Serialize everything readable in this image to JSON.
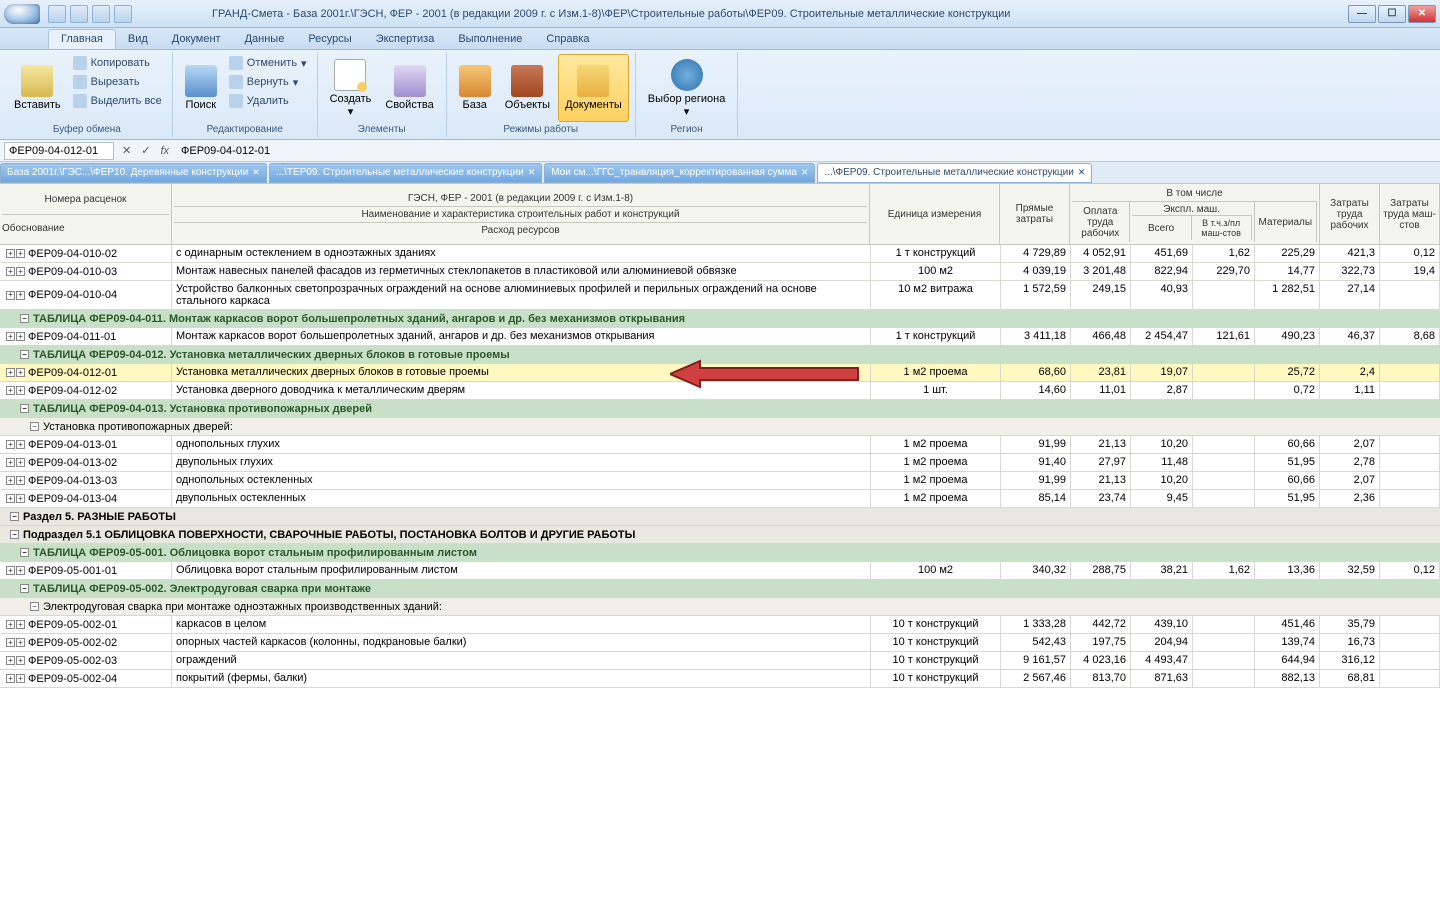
{
  "title": "ГРАНД-Смета - База 2001г.\\ГЭСН, ФЕР - 2001 (в редакции 2009 г. с Изм.1-8)\\ФЕР\\Строительные работы\\ФЕР09. Строительные металлические конструкции",
  "ribbon_tabs": [
    "Главная",
    "Вид",
    "Документ",
    "Данные",
    "Ресурсы",
    "Экспертиза",
    "Выполнение",
    "Справка"
  ],
  "ribbon": {
    "clipboard": {
      "paste": "Вставить",
      "copy": "Копировать",
      "cut": "Вырезать",
      "select_all": "Выделить все",
      "label": "Буфер обмена"
    },
    "edit": {
      "search": "Поиск",
      "undo": "Отменить",
      "redo": "Вернуть",
      "delete": "Удалить",
      "label": "Редактирование"
    },
    "elements": {
      "create": "Создать",
      "props": "Свойства",
      "label": "Элементы"
    },
    "modes": {
      "base": "База",
      "objects": "Объекты",
      "docs": "Документы",
      "label": "Режимы работы"
    },
    "region": {
      "select": "Выбор региона",
      "label": "Регион"
    }
  },
  "formula": {
    "name": "ФЕР09-04-012-01",
    "value": "ФЕР09-04-012-01"
  },
  "doc_tabs": [
    "База 2001г.\\ГЭС...\\ФЕР10. Деревянные конструкции",
    "...\\ТЕР09. Строительные металлические конструкции",
    "Мои см...\\ГГС_транвляция_корректированная сумма",
    "...\\ФЕР09. Строительные металлические конструкции"
  ],
  "columns": {
    "numbers": "Номера расценок",
    "basis": "Обоснование",
    "db": "ГЭСН, ФЕР - 2001 (в редакции 2009 г. с Изм.1-8)",
    "name": "Наименование и характеристика строительных работ и конструкций",
    "consumption": "Расход ресурсов",
    "unit": "Единица измерения",
    "direct": "Прямые затраты",
    "including": "В том числе",
    "wages": "Оплата труда рабочих",
    "mach": "Экспл. маш.",
    "total": "Всего",
    "incl_wages": "В т.ч.з/пл маш-стов",
    "materials": "Материалы",
    "labor_workers": "Затраты труда рабочих",
    "labor_mach": "Затраты труда маш-стов"
  },
  "rows": [
    {
      "type": "data",
      "code": "ФЕР09-04-010-02",
      "name": "с одинарным остеклением в одноэтажных зданиях",
      "unit": "1 т конструкций",
      "v": [
        "4 729,89",
        "4 052,91",
        "451,69",
        "1,62",
        "225,29",
        "421,3",
        "0,12"
      ]
    },
    {
      "type": "data",
      "code": "ФЕР09-04-010-03",
      "name": "Монтаж навесных панелей фасадов из герметичных стеклопакетов в пластиковой или алюминиевой обвязке",
      "unit": "100 м2",
      "v": [
        "4 039,19",
        "3 201,48",
        "822,94",
        "229,70",
        "14,77",
        "322,73",
        "19,4"
      ]
    },
    {
      "type": "data",
      "code": "ФЕР09-04-010-04",
      "name": "Устройство балконных светопрозрачных ограждений на основе алюминиевых профилей и перильных ограждений на основе стального каркаса",
      "unit": "10 м2 витража",
      "v": [
        "1 572,59",
        "249,15",
        "40,93",
        "",
        "1 282,51",
        "27,14",
        ""
      ]
    },
    {
      "type": "subheader",
      "name": "ТАБЛИЦА ФЕР09-04-011. Монтаж каркасов ворот большепролетных зданий, ангаров и др. без механизмов открывания"
    },
    {
      "type": "data",
      "code": "ФЕР09-04-011-01",
      "name": "Монтаж каркасов ворот большепролетных зданий, ангаров и др. без механизмов открывания",
      "unit": "1 т конструкций",
      "v": [
        "3 411,18",
        "466,48",
        "2 454,47",
        "121,61",
        "490,23",
        "46,37",
        "8,68"
      ]
    },
    {
      "type": "subheader",
      "name": "ТАБЛИЦА ФЕР09-04-012. Установка металлических дверных блоков в готовые проемы"
    },
    {
      "type": "highlight",
      "code": "ФЕР09-04-012-01",
      "name": "Установка металлических дверных блоков в готовые проемы",
      "unit": "1 м2 проема",
      "v": [
        "68,60",
        "23,81",
        "19,07",
        "",
        "25,72",
        "2,4",
        ""
      ],
      "arrow": true
    },
    {
      "type": "data",
      "code": "ФЕР09-04-012-02",
      "name": "Установка дверного доводчика к металлическим дверям",
      "unit": "1 шт.",
      "v": [
        "14,60",
        "11,01",
        "2,87",
        "",
        "0,72",
        "1,11",
        ""
      ]
    },
    {
      "type": "subheader",
      "name": "ТАБЛИЦА ФЕР09-04-013. Установка противопожарных дверей"
    },
    {
      "type": "group",
      "name": "Установка противопожарных дверей:"
    },
    {
      "type": "data",
      "code": "ФЕР09-04-013-01",
      "name": "однопольных глухих",
      "unit": "1 м2 проема",
      "v": [
        "91,99",
        "21,13",
        "10,20",
        "",
        "60,66",
        "2,07",
        ""
      ]
    },
    {
      "type": "data",
      "code": "ФЕР09-04-013-02",
      "name": "двупольных глухих",
      "unit": "1 м2 проема",
      "v": [
        "91,40",
        "27,97",
        "11,48",
        "",
        "51,95",
        "2,78",
        ""
      ]
    },
    {
      "type": "data",
      "code": "ФЕР09-04-013-03",
      "name": "однопольных остекленных",
      "unit": "1 м2 проема",
      "v": [
        "91,99",
        "21,13",
        "10,20",
        "",
        "60,66",
        "2,07",
        ""
      ]
    },
    {
      "type": "data",
      "code": "ФЕР09-04-013-04",
      "name": "двупольных остекленных",
      "unit": "1 м2 проема",
      "v": [
        "85,14",
        "23,74",
        "9,45",
        "",
        "51,95",
        "2,36",
        ""
      ]
    },
    {
      "type": "section",
      "name": "Раздел 5. РАЗНЫЕ РАБОТЫ"
    },
    {
      "type": "section",
      "name": "Подраздел 5.1 ОБЛИЦОВКА ПОВЕРХНОСТИ, СВАРОЧНЫЕ РАБОТЫ, ПОСТАНОВКА БОЛТОВ И ДРУГИЕ РАБОТЫ"
    },
    {
      "type": "subheader",
      "name": "ТАБЛИЦА ФЕР09-05-001. Облицовка ворот стальным профилированным листом"
    },
    {
      "type": "data",
      "code": "ФЕР09-05-001-01",
      "name": "Облицовка ворот стальным профилированным листом",
      "unit": "100 м2",
      "v": [
        "340,32",
        "288,75",
        "38,21",
        "1,62",
        "13,36",
        "32,59",
        "0,12"
      ]
    },
    {
      "type": "subheader",
      "name": "ТАБЛИЦА ФЕР09-05-002. Электродуговая сварка при монтаже"
    },
    {
      "type": "group",
      "name": "Электродуговая сварка при монтаже одноэтажных производственных зданий:"
    },
    {
      "type": "data",
      "code": "ФЕР09-05-002-01",
      "name": "каркасов в целом",
      "unit": "10 т конструкций",
      "v": [
        "1 333,28",
        "442,72",
        "439,10",
        "",
        "451,46",
        "35,79",
        ""
      ]
    },
    {
      "type": "data",
      "code": "ФЕР09-05-002-02",
      "name": "опорных частей каркасов (колонны, подкрановые балки)",
      "unit": "10 т конструкций",
      "v": [
        "542,43",
        "197,75",
        "204,94",
        "",
        "139,74",
        "16,73",
        ""
      ]
    },
    {
      "type": "data",
      "code": "ФЕР09-05-002-03",
      "name": "ограждений",
      "unit": "10 т конструкций",
      "v": [
        "9 161,57",
        "4 023,16",
        "4 493,47",
        "",
        "644,94",
        "316,12",
        ""
      ]
    },
    {
      "type": "data",
      "code": "ФЕР09-05-002-04",
      "name": "покрытий (фермы, балки)",
      "unit": "10 т конструкций",
      "v": [
        "2 567,46",
        "813,70",
        "871,63",
        "",
        "882,13",
        "68,81",
        ""
      ]
    }
  ]
}
